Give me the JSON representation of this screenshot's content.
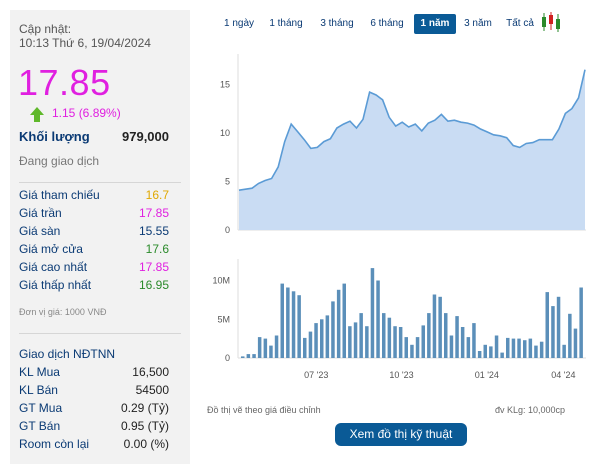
{
  "quote": {
    "updated_label": "Cập nhật:",
    "updated_time": "10:13 Thứ 6, 19/04/2024",
    "price": "17.85",
    "change": "1.15 (6.89%)",
    "change_direction": "up",
    "volume_label": "Khối lượng",
    "volume_value": "979,000",
    "status": "Đang giao dịch",
    "rows": [
      {
        "label": "Giá tham chiếu",
        "value": "16.7",
        "color": "#e0a800"
      },
      {
        "label": "Giá trần",
        "value": "17.85",
        "color": "#e020e0"
      },
      {
        "label": "Giá sàn",
        "value": "15.55",
        "color": "#0a3a74"
      },
      {
        "label": "Giá mở cửa",
        "value": "17.6",
        "color": "#2a8a2a"
      },
      {
        "label": "Giá cao nhất",
        "value": "17.85",
        "color": "#e020e0"
      },
      {
        "label": "Giá thấp nhất",
        "value": "16.95",
        "color": "#2a8a2a"
      }
    ],
    "unit_note": "Đơn vị giá: 1000 VNĐ"
  },
  "foreign": {
    "title": "Giao dịch NĐTNN",
    "rows": [
      {
        "label": "KL Mua",
        "value": "16,500"
      },
      {
        "label": "KL Bán",
        "value": "54500"
      },
      {
        "label": "GT Mua",
        "value": "0.29 (Tỷ)"
      },
      {
        "label": "GT Bán",
        "value": "0.95 (Tỷ)"
      },
      {
        "label": "Room còn lại",
        "value": "0.00 (%)"
      }
    ]
  },
  "tabs": [
    "1 ngày",
    "1 tháng",
    "3 tháng",
    "6 tháng",
    "1 năm",
    "3 năm",
    "Tất cả"
  ],
  "active_tab": "1 năm",
  "icons": {
    "change": "up-arrow-icon",
    "chart_type": "candlestick-icon"
  },
  "colors": {
    "accent": "#0a5a96",
    "price_up": "#e020e0",
    "line": "#5b9bd5",
    "area": "#c9dcf3",
    "volume_bar": "#5b8fb9"
  },
  "footer": {
    "left_note": "Đồ thị vẽ theo giá điều chỉnh",
    "right_note": "đv KLg: 10,000cp",
    "button_label": "Xem đồ thị kỹ thuật"
  },
  "chart_data": [
    {
      "type": "area",
      "title": "",
      "y_ticks": [
        "0",
        "5",
        "10",
        "15"
      ],
      "ylim": [
        0,
        17.5
      ],
      "x_ticks": [
        "07 '23",
        "10 '23",
        "01 '24",
        "04 '24"
      ],
      "values": [
        4.1,
        4.2,
        4.3,
        4.8,
        5.1,
        5.3,
        6.5,
        9.1,
        10.9,
        10.1,
        9.3,
        8.4,
        8.5,
        9.1,
        9.4,
        10.5,
        10.9,
        11.2,
        10.5,
        11.4,
        14.2,
        13.9,
        13.4,
        11.6,
        10.7,
        11.1,
        10.6,
        10.9,
        10.2,
        11.0,
        11.3,
        11.9,
        11.2,
        11.3,
        11.1,
        11.0,
        10.8,
        10.4,
        10.1,
        9.8,
        9.7,
        9.5,
        8.7,
        8.5,
        8.9,
        9.0,
        9.3,
        9.3,
        9.3,
        10.4,
        12.0,
        12.5,
        13.6,
        16.5
      ]
    },
    {
      "type": "bar",
      "title": "",
      "y_ticks": [
        "0",
        "5M",
        "10M"
      ],
      "ylim": [
        0,
        12
      ],
      "x_ticks": [
        "07 '23",
        "10 '23",
        "01 '24",
        "04 '24"
      ],
      "values": [
        0.2,
        0.5,
        0.5,
        2.7,
        2.5,
        1.6,
        2.9,
        9.6,
        9.1,
        8.6,
        8.1,
        2.6,
        3.4,
        4.5,
        5.0,
        5.5,
        7.3,
        8.8,
        9.6,
        4.1,
        4.6,
        5.8,
        4.1,
        11.6,
        10.0,
        5.8,
        5.2,
        4.1,
        4.0,
        2.7,
        1.7,
        2.7,
        4.2,
        5.8,
        8.2,
        7.9,
        5.8,
        2.9,
        5.4,
        4.0,
        2.7,
        4.5,
        0.9,
        1.7,
        1.5,
        2.9,
        0.7,
        2.6,
        2.5,
        2.5,
        2.3,
        2.5,
        1.6,
        2.1,
        8.5,
        6.7,
        7.9,
        1.7,
        5.7,
        3.8,
        9.1
      ]
    }
  ]
}
